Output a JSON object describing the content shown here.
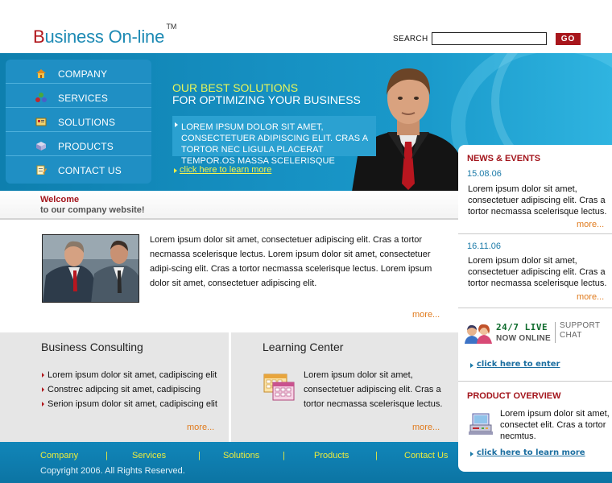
{
  "header": {
    "logo_initial": "B",
    "logo_rest": "usiness On-line",
    "logo_tm": "TM",
    "search_label": "SEARCH",
    "search_value": "",
    "go_label": "GO"
  },
  "nav": {
    "items": [
      {
        "label": "COMPANY",
        "icon": "home-icon"
      },
      {
        "label": "SERVICES",
        "icon": "services-icon"
      },
      {
        "label": "SOLUTIONS",
        "icon": "solutions-icon"
      },
      {
        "label": "PRODUCTS",
        "icon": "products-icon"
      },
      {
        "label": "CONTACT US",
        "icon": "contact-icon"
      }
    ]
  },
  "hero": {
    "title_line1": "OUR BEST SOLUTIONS",
    "title_line2": "FOR OPTIMIZING YOUR BUSINESS",
    "box_text": "LOREM IPSUM DOLOR SIT AMET, CONSECTETUER ADIPISCING ELIT. CRAS A TORTOR NEC LIGULA PLACERAT TEMPOR.OS MASSA SCELERISQUE",
    "link_label": "click here to learn more"
  },
  "welcome": {
    "title": "Welcome",
    "subtitle": "to our company website!",
    "text": "Lorem ipsum dolor sit amet, consectetuer adipiscing elit. Cras a tortor necmassa scelerisque lectus. Lorem ipsum dolor sit amet, consectetuer adipi-scing elit. Cras a tortor necmassa scelerisque lectus. Lorem ipsum dolor sit amet, consectetuer adipiscing elit.",
    "more": "more..."
  },
  "consulting": {
    "title": "Business Consulting",
    "bullets": [
      "Lorem ipsum dolor sit amet, cadipiscing elit",
      "Constrec adipcing sit amet, cadipiscing",
      "Serion ipsum dolor sit amet, cadipiscing elit"
    ],
    "more": "more..."
  },
  "learning": {
    "title": "Learning Center",
    "text": "Lorem ipsum dolor sit amet, consectetuer adipiscing elit. Cras a tortor necmassa scelerisque lectus.",
    "more": "more..."
  },
  "news": {
    "title": "NEWS & EVENTS",
    "items": [
      {
        "date": "15.08.06",
        "text": "Lorem ipsum dolor sit amet, consectetuer adipiscing elit. Cras a tortor necmassa scelerisque lectus.",
        "more": "more..."
      },
      {
        "date": "16.11.06",
        "text": "Lorem ipsum dolor sit amet, consectetuer adipiscing elit. Cras a tortor necmassa scelerisque lectus.",
        "more": "more..."
      }
    ]
  },
  "chat": {
    "title": "24/7 LIVE",
    "subtitle": "NOW ONLINE",
    "label_line1": "SUPPORT",
    "label_line2": "CHAT",
    "link_label": "click here to enter"
  },
  "product": {
    "title": "PRODUCT OVERVIEW",
    "text": "Lorem ipsum dolor sit amet, consectet elit. Cras a tortor necmtus.",
    "link_label": "click here to learn more"
  },
  "footer": {
    "links": [
      "Company",
      "Services",
      "Solutions",
      "Products",
      "Contact Us"
    ],
    "separator": "|",
    "copyright": "Copyright 2006. All Rights Reserved."
  },
  "colors": {
    "brand_blue": "#1690c2",
    "brand_red": "#a8161c",
    "link_yellow": "#ecec3c",
    "more_orange": "#e07a1c"
  }
}
